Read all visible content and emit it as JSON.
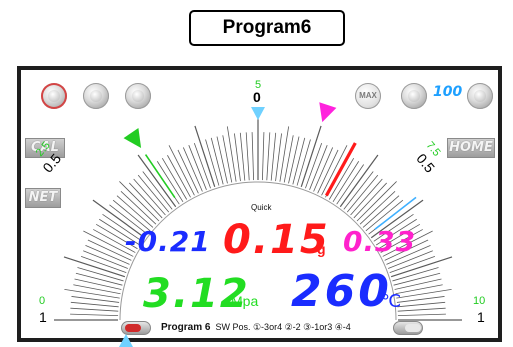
{
  "header": {
    "program_tag": "Program6"
  },
  "gauge": {
    "top_mark": {
      "green": "5",
      "black": "0"
    },
    "left_mid_mark": {
      "green": "2.5",
      "black": "0.5"
    },
    "right_mid_mark": {
      "green": "7.5",
      "black": "0.5"
    },
    "left_end_mark": {
      "green": "0",
      "black": "1"
    },
    "right_end_mark": {
      "green": "10",
      "black": "1"
    },
    "mode_label": "Quick",
    "needle_value": 6.6,
    "green_marker": 3.1,
    "magenta_marker": 6.0,
    "cyan_marker": 7.9,
    "top_pointer": 5.0
  },
  "buttons": {
    "cal": "CAL",
    "net": "NET",
    "home": "HOME",
    "max": "MAX"
  },
  "speed_display": "100",
  "readouts": {
    "left_small": "-0.21",
    "main_value": "0.15",
    "main_unit": "g",
    "right_small": "0.33",
    "pressure_value": "3.12",
    "pressure_unit": "Mpa",
    "temperature_value": "260",
    "temperature_unit": "℃"
  },
  "footer": {
    "program": "Program 6",
    "sw_text": "SW Pos. ①-3or4 ②-2 ③-1or3 ④-4"
  },
  "colors": {
    "needle": "#ff1a1a",
    "green_marker": "#22cc22",
    "magenta_marker": "#ff22dd",
    "cyan_marker": "#3fb0ff",
    "cyan_pointer": "#6fd1ff",
    "blue_text": "#1a2cff",
    "green_text": "#22dd22",
    "red_text": "#ff1a1a",
    "magenta_text": "#ff22cc"
  }
}
